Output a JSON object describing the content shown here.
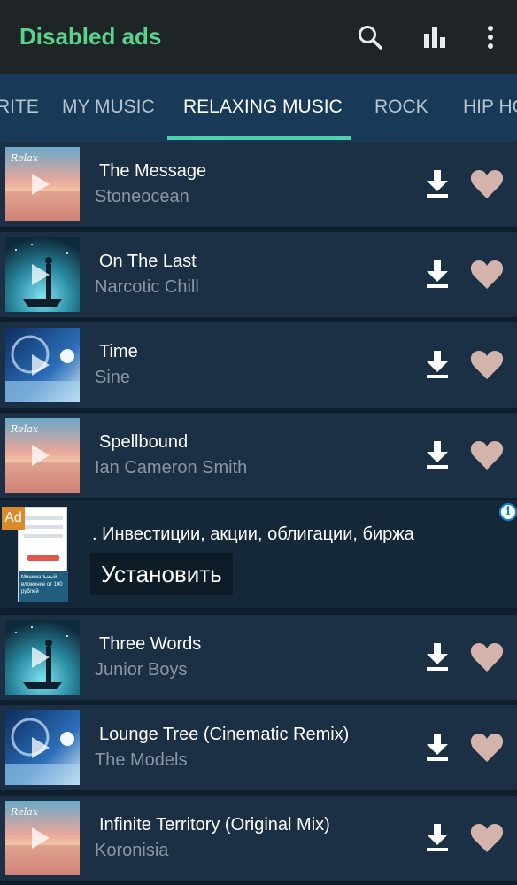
{
  "appbar": {
    "title": "Disabled ads",
    "icons": [
      "search-icon",
      "equalizer-icon",
      "more-vert-icon"
    ]
  },
  "tabs": [
    {
      "label": "RITE",
      "active": false
    },
    {
      "label": "MY MUSIC",
      "active": false
    },
    {
      "label": "RELAXING MUSIC",
      "active": true
    },
    {
      "label": "ROCK",
      "active": false
    },
    {
      "label": "HIP HO",
      "active": false
    }
  ],
  "songs": [
    {
      "title": "The Message",
      "artist": "Stoneocean",
      "art": "sunset"
    },
    {
      "title": "On The Last",
      "artist": "Narcotic Chill",
      "art": "boat"
    },
    {
      "title": "Time",
      "artist": "Sine",
      "art": "moon"
    },
    {
      "title": "Spellbound",
      "artist": "Ian Cameron Smith",
      "art": "sunset"
    },
    {
      "title": "Three Words",
      "artist": "Junior Boys",
      "art": "boat"
    },
    {
      "title": "Lounge Tree (Cinematic Remix)",
      "artist": "The Models",
      "art": "moon"
    },
    {
      "title": "Infinite Territory (Original Mix)",
      "artist": "Koronisia",
      "art": "sunset"
    }
  ],
  "ad": {
    "badge": "Ad",
    "text": ". Инвестиции, акции, облигации, биржа",
    "button": "Установить",
    "info": "i",
    "image_caption": "Минимальный вложение от 100 рублей"
  },
  "colors": {
    "accent": "#57d38c",
    "tab_indicator": "#4fd1b0",
    "heart": "#d3b4ad",
    "row_bg": "#1b2f45"
  }
}
